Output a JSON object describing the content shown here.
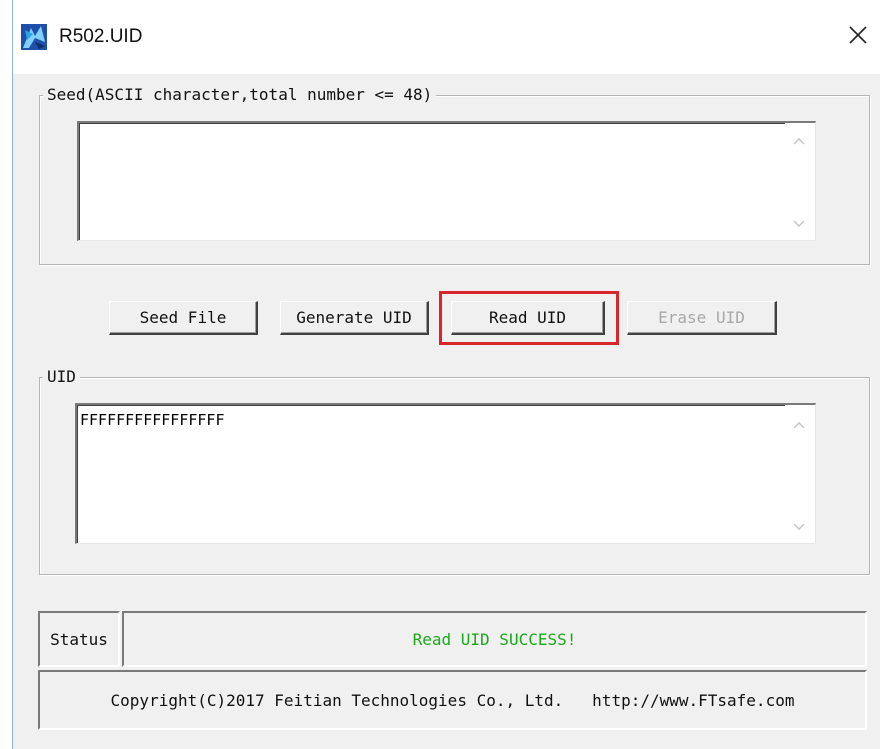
{
  "window": {
    "title": "R502.UID",
    "close_glyph": "✕"
  },
  "seed_group": {
    "label": "Seed(ASCII character,total number <= 48)",
    "value": ""
  },
  "buttons": {
    "seed_file": "Seed File",
    "generate_uid": "Generate UID",
    "read_uid": "Read UID",
    "erase_uid": "Erase UID"
  },
  "uid_group": {
    "label": "UID",
    "value": "FFFFFFFFFFFFFFFF"
  },
  "status": {
    "label": "Status",
    "message": "Read UID SUCCESS!"
  },
  "footer": {
    "copyright": "Copyright(C)2017 Feitian Technologies Co., Ltd.   http://www.FTsafe.com"
  },
  "colors": {
    "status_success": "#1aa81a",
    "highlight": "#d6262c",
    "disabled_text": "#a8a8a8"
  },
  "icons": {
    "app": "app-icon",
    "close": "close-icon",
    "scroll_up": "scroll-up-arrow-icon",
    "scroll_down": "scroll-down-arrow-icon"
  }
}
